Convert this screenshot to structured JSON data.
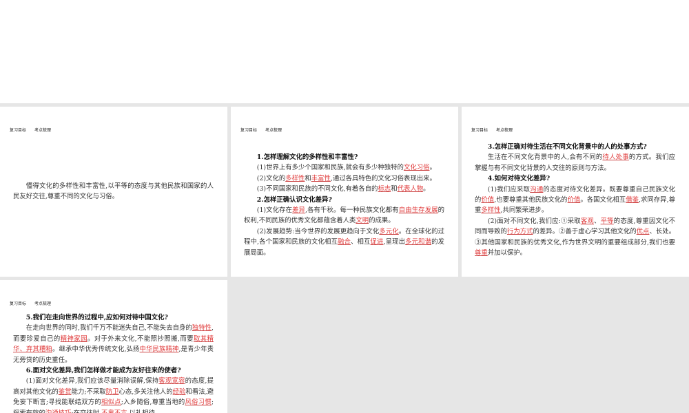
{
  "header": {
    "tab1": "复习目标",
    "tab2": "考点梳理"
  },
  "slides": [
    {
      "paras": [
        {
          "h": false,
          "segs": [
            {
              "t": "懂得文化的多样性和丰富性,以平等的态度与其他民族和国家的人民友好交往,尊重不同的文化与习俗。"
            }
          ]
        }
      ]
    },
    {
      "paras": [
        {
          "h": true,
          "segs": [
            {
              "t": "1.怎样理解文化的多样性和丰富性?"
            }
          ]
        },
        {
          "h": false,
          "segs": [
            {
              "t": "(1)世界上有多少个国家和民族,就会有多少种独特的"
            },
            {
              "t": "文化习俗",
              "hl": true
            },
            {
              "t": "。"
            }
          ]
        },
        {
          "h": false,
          "segs": [
            {
              "t": "(2)文化的"
            },
            {
              "t": "多样性",
              "hl": true
            },
            {
              "t": "和"
            },
            {
              "t": "丰富性",
              "hl": true
            },
            {
              "t": ",通过各具特色的文化习俗表现出来。"
            }
          ]
        },
        {
          "h": false,
          "segs": [
            {
              "t": "(3)不同国家和民族的不同文化,有着各自的"
            },
            {
              "t": "标志",
              "hl": true
            },
            {
              "t": "和"
            },
            {
              "t": "代表人物",
              "hl": true
            },
            {
              "t": "。"
            }
          ]
        },
        {
          "h": true,
          "segs": [
            {
              "t": "2.怎样正确认识文化差异?"
            }
          ]
        },
        {
          "h": false,
          "segs": [
            {
              "t": "(1)文化存在"
            },
            {
              "t": "差异",
              "hl": true
            },
            {
              "t": ",各有千秋。每一种民族文化都有"
            },
            {
              "t": "自由生存发展",
              "hl": true
            },
            {
              "t": "的权利,不同民族的优秀文化都蕴含着人类"
            },
            {
              "t": "文明",
              "hl": true
            },
            {
              "t": "的成果。"
            }
          ]
        },
        {
          "h": false,
          "segs": [
            {
              "t": "(2)发展趋势:当今世界的发展更趋向于文化"
            },
            {
              "t": "多元化",
              "hl": true
            },
            {
              "t": "。在全球化的过程中,各个国家和民族的文化相互"
            },
            {
              "t": "融合",
              "hl": true
            },
            {
              "t": "、相互"
            },
            {
              "t": "促进",
              "hl": true
            },
            {
              "t": ",呈现出"
            },
            {
              "t": "多元和谐",
              "hl": true
            },
            {
              "t": "的发展局面。"
            }
          ]
        }
      ]
    },
    {
      "paras": [
        {
          "h": true,
          "segs": [
            {
              "t": "3.怎样正确对待生活在不同文化背景中的人的处事方式?"
            }
          ]
        },
        {
          "h": false,
          "segs": [
            {
              "t": "生活在不同文化背景中的人,会有不同的"
            },
            {
              "t": "待人处事",
              "hl": true
            },
            {
              "t": "的方式。我们应掌握与有不同文化背景的人交往的原则与方法。"
            }
          ]
        },
        {
          "h": true,
          "segs": [
            {
              "t": "4.如何对待文化差异?"
            }
          ]
        },
        {
          "h": false,
          "segs": [
            {
              "t": "(1)我们应采取"
            },
            {
              "t": "沟通",
              "hl": true
            },
            {
              "t": "的态度对待文化差异。既要尊重自己民族文化的"
            },
            {
              "t": "价值",
              "hl": true
            },
            {
              "t": ",也要尊重其他民族文化的"
            },
            {
              "t": "价值",
              "hl": true
            },
            {
              "t": "。各国文化相互"
            },
            {
              "t": "借鉴",
              "hl": true
            },
            {
              "t": ",求同存异,尊重"
            },
            {
              "t": "多样性",
              "hl": true
            },
            {
              "t": ",共同繁荣进步。"
            }
          ]
        },
        {
          "h": false,
          "segs": [
            {
              "t": "(2)面对不同文化,我们应:①采取"
            },
            {
              "t": "客观",
              "hl": true
            },
            {
              "t": "、"
            },
            {
              "t": "平等",
              "hl": true
            },
            {
              "t": "的态度,尊重因文化不同而导致的"
            },
            {
              "t": "行为方式",
              "hl": true
            },
            {
              "t": "的差异。②善于虚心学习其他文化的"
            },
            {
              "t": "优点",
              "hl": true
            },
            {
              "t": "、长处。③其他国家和民族的优秀文化,作为世界文明的重要组成部分,我们也要"
            },
            {
              "t": "尊重",
              "hl": true
            },
            {
              "t": "并加以保护。"
            }
          ]
        }
      ]
    },
    {
      "paras": [
        {
          "h": true,
          "segs": [
            {
              "t": "5.我们在走向世界的过程中,应如何对待中国文化?"
            }
          ]
        },
        {
          "h": false,
          "segs": [
            {
              "t": "在走向世界的同时,我们千万不能迷失自己,不能失去自身的"
            },
            {
              "t": "独特性",
              "hl": true
            },
            {
              "t": ",而要珍爱自己的"
            },
            {
              "t": "精神家园",
              "hl": true
            },
            {
              "t": "。对于外来文化,不能照抄照搬,而要"
            },
            {
              "t": "取其精华、弃其糟粕",
              "hl": true
            },
            {
              "t": "。继承中华优秀传统文化,弘扬"
            },
            {
              "t": "中华民族精神",
              "hl": true
            },
            {
              "t": ",是青少年责无旁贷的历史重任。"
            }
          ]
        },
        {
          "h": true,
          "segs": [
            {
              "t": "6.面对文化差异,我们怎样做才能成为友好往来的使者?"
            }
          ]
        },
        {
          "h": false,
          "segs": [
            {
              "t": "(1)面对文化差异,我们应该尽量消除误解,保持"
            },
            {
              "t": "客观宽容",
              "hl": true
            },
            {
              "t": "的态度,提高对其他文化的"
            },
            {
              "t": "鉴赏",
              "hl": true
            },
            {
              "t": "能力;不采取"
            },
            {
              "t": "防卫",
              "hl": true
            },
            {
              "t": "心态,多关注他人的"
            },
            {
              "t": "经验",
              "hl": true
            },
            {
              "t": "和看法,避免妄下断言;寻找能联结双方的"
            },
            {
              "t": "相似点",
              "hl": true
            },
            {
              "t": ";入乡随俗,尊重当地的"
            },
            {
              "t": "风俗习惯",
              "hl": true
            },
            {
              "t": ";探索有效的"
            },
            {
              "t": "沟通技巧",
              "hl": true
            },
            {
              "t": ";在交往时,"
            },
            {
              "t": "不卑不亢",
              "hl": true
            },
            {
              "t": ",以礼相待。"
            }
          ]
        }
      ]
    }
  ]
}
